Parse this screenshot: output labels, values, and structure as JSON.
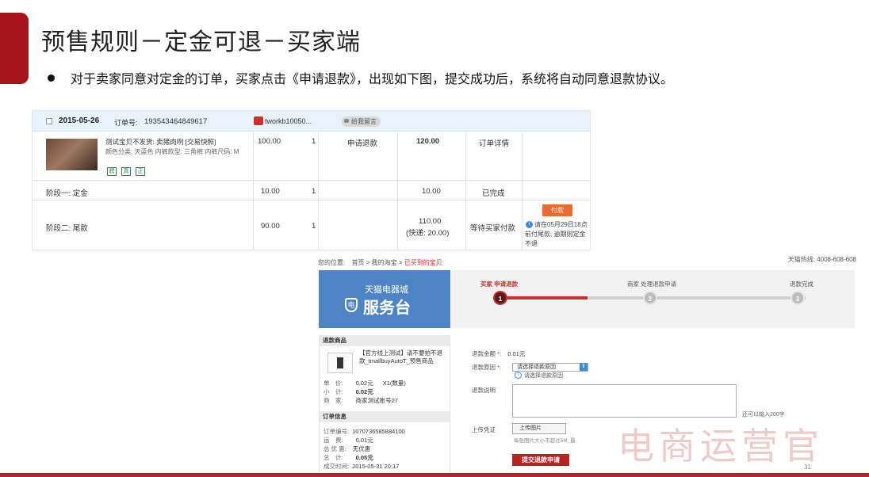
{
  "slide": {
    "title": "预售规则－定金可退－买家端",
    "bullet": "对于卖家同意对定金的订单，买家点击《申请退款》，出现如下图，提交成功后，系统将自动同意退款协议。",
    "watermark": "电商运营官",
    "page_number": "31",
    "accent_color": "#a5131b"
  },
  "order": {
    "date": "2015-05-26",
    "order_no_label": "订单号:",
    "order_no": "193543464849617",
    "shop_name": "tworkb10050...",
    "message_label": "给我留言",
    "product": {
      "title": "测试宝贝不发货:   卖猪肉咧 [交易快照]",
      "attrs": "颜色分类: 天蓝色  内裤款型: 三角裤  内裤尺码: M",
      "tags": [
        "聘",
        "真",
        "正"
      ],
      "price": "100.00",
      "qty": "1",
      "refund_link": "申请退款",
      "total": "120.00",
      "detail_link": "订单详情"
    },
    "stage1": {
      "label": "阶段一: 定金",
      "price": "10.00",
      "qty": "1",
      "amount": "10.00",
      "status": "已完成"
    },
    "stage2": {
      "label": "阶段二: 尾款",
      "price": "90.00",
      "qty": "1",
      "amount": "110.00",
      "shipping": "(快递: 20.00)",
      "status": "等待买家付款",
      "pay_button": "付款",
      "note": "请在05月29日18点前付尾款; 逾期则定金不退"
    }
  },
  "refund": {
    "breadcrumb_label": "您的位置:",
    "crumbs": [
      "首页",
      "我的淘宝",
      "已买到的宝贝"
    ],
    "hotline": "天猫热线: 4008-608-608",
    "brand": "天猫电器城",
    "service": "服务台",
    "shield_char": "电",
    "steps": [
      {
        "label": "买家 申请退款",
        "num": "1"
      },
      {
        "label": "商家 处理退款申请",
        "num": "2"
      },
      {
        "label": "退款完成",
        "num": "3"
      }
    ],
    "goods_section": "退款商品",
    "goods_name": "【官方线上测试】请不要拍不退款_tmallbuyAutoT_预售商品",
    "unit_price_label": "单　价:",
    "unit_price": "0.02元",
    "qty_text": "X1(数量)",
    "subtotal_label": "小　计:",
    "subtotal": "0.02元",
    "seller_label": "商　家:",
    "seller": "商家测试账号27",
    "order_section": "订单信息",
    "order_no_label": "订单编号:",
    "order_no": "1070736585884100",
    "shipping_label": "运　费:",
    "shipping": "0.01元",
    "discount_label": "总 优 惠:",
    "discount": "无优惠",
    "total_label": "总　计:",
    "total": "0.05元",
    "deal_time_label": "成交时间:",
    "deal_time": "2015-05-31 20:17",
    "amount_label": "退款金额",
    "amount": "0.01元",
    "reason_label": "退款原因",
    "reason_placeholder": "请选择退款原因",
    "reason_hint": "请选择退款原因",
    "desc_label": "退款说明",
    "counter": "还可以输入200字",
    "proof_label": "上传凭证",
    "upload_button": "上传图片",
    "upload_note": "每张图片大小不超过5M, 最",
    "submit_button": "提交退款申请"
  }
}
